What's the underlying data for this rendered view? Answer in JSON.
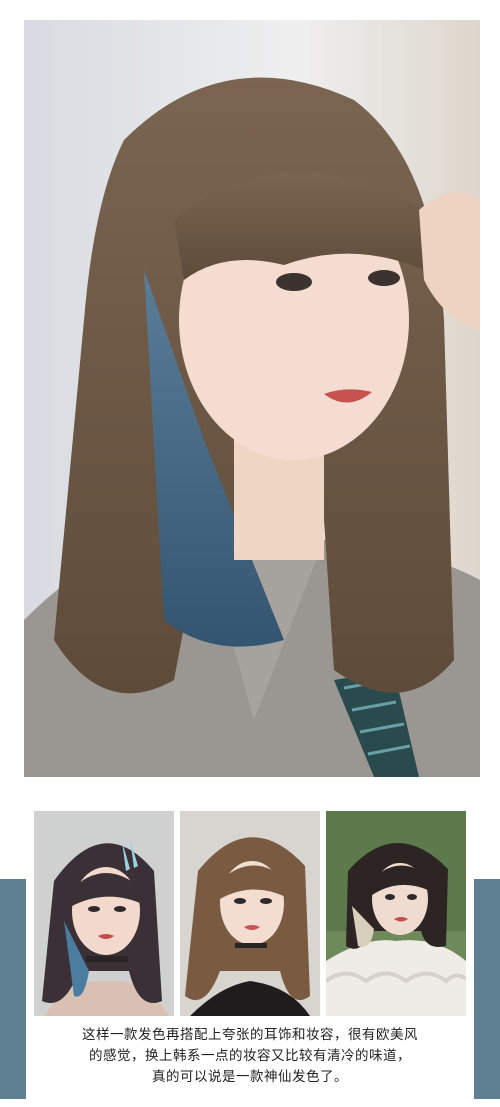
{
  "photos": {
    "hero": {
      "subject": "woman-long-hair-with-blue-underlayer",
      "hair_color": "#6e5a45",
      "accent_hair": "#3f6c8c",
      "top_color": "#9a9792",
      "tie_color": "#24474a"
    },
    "thumbnails": [
      {
        "subject": "dark-hair-blue-highlight-with-clips",
        "hair_color": "#3a3036",
        "accent_hair": "#4b7da0"
      },
      {
        "subject": "light-brown-long-hair",
        "hair_color": "#7a5a40",
        "accent_hair": "#8a6a4c"
      },
      {
        "subject": "bob-hair-with-blonde-underlayer",
        "hair_color": "#2c2523",
        "accent_hair": "#d8cfbc"
      }
    ]
  },
  "caption": {
    "line1": "这样一款发色再搭配上夸张的耳饰和妆容，很有欧美风",
    "line2": "的感觉，换上韩系一点的妆容又比较有清冷的味道，",
    "line3": "真的可以说是一款神仙发色了。"
  },
  "colors": {
    "accent_bar": "#5f7f93",
    "caption_text": "#222222"
  }
}
